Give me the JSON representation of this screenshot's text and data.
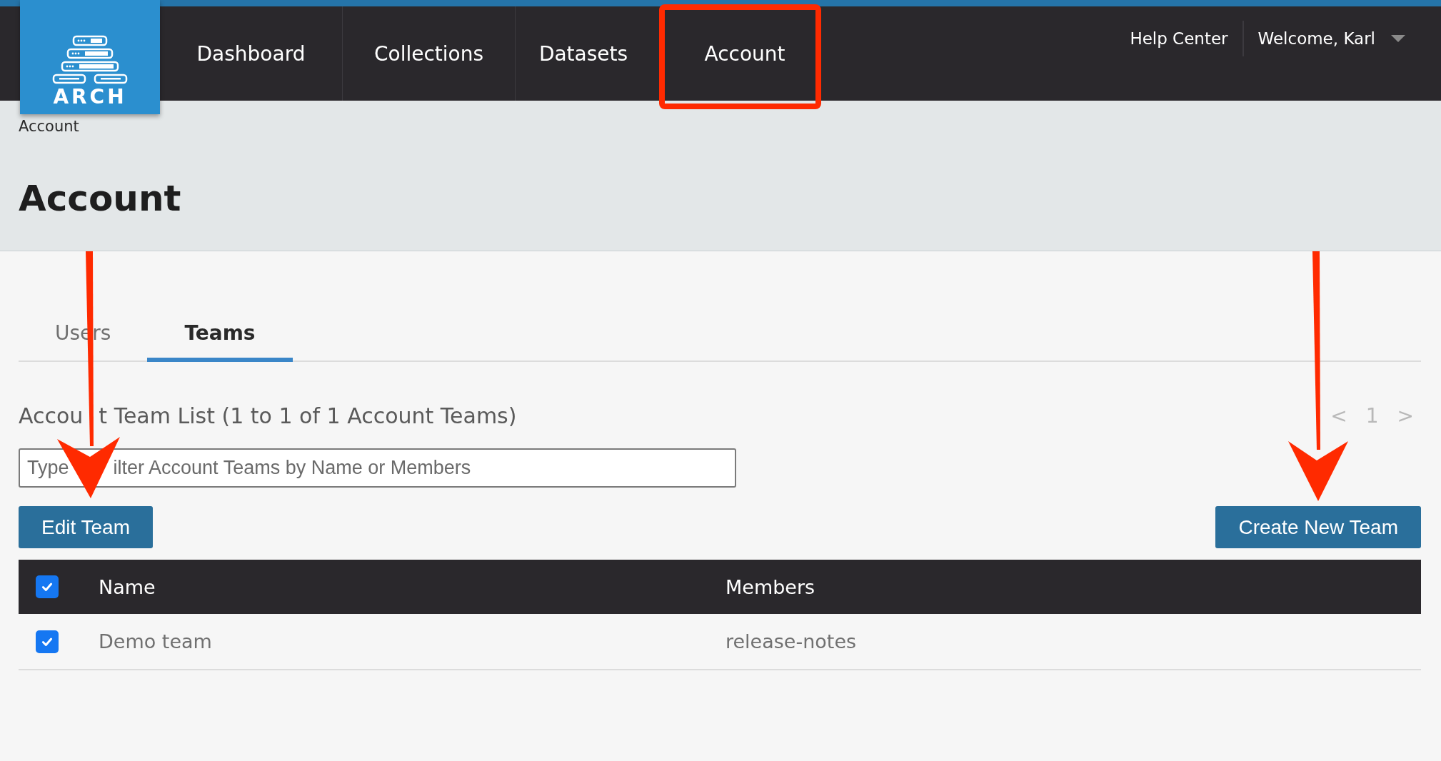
{
  "header": {
    "logo_text": "ARCH",
    "nav": [
      {
        "label": "Dashboard"
      },
      {
        "label": "Collections"
      },
      {
        "label": "Datasets"
      },
      {
        "label": "Account"
      }
    ],
    "help": "Help Center",
    "user_menu": "Welcome, Karl"
  },
  "breadcrumb": "Account",
  "page_title": "Account",
  "tabs": [
    {
      "label": "Users",
      "selected": false
    },
    {
      "label": "Teams",
      "selected": true
    }
  ],
  "list_heading": [
    "Accou",
    "t Team List (1 to 1 of 1 Account Teams)"
  ],
  "pagination": {
    "prev": "<",
    "page": "1",
    "next": ">"
  },
  "filter": {
    "placeholder_parts": [
      "Type",
      "ilter Account Teams by Name or Members"
    ]
  },
  "buttons": {
    "edit": "Edit Team",
    "create": "Create New Team"
  },
  "table": {
    "select_all_checked": true,
    "columns": [
      "Name",
      "Members"
    ],
    "rows": [
      {
        "checked": true,
        "cells": [
          "Demo team",
          "release-notes"
        ]
      }
    ]
  }
}
